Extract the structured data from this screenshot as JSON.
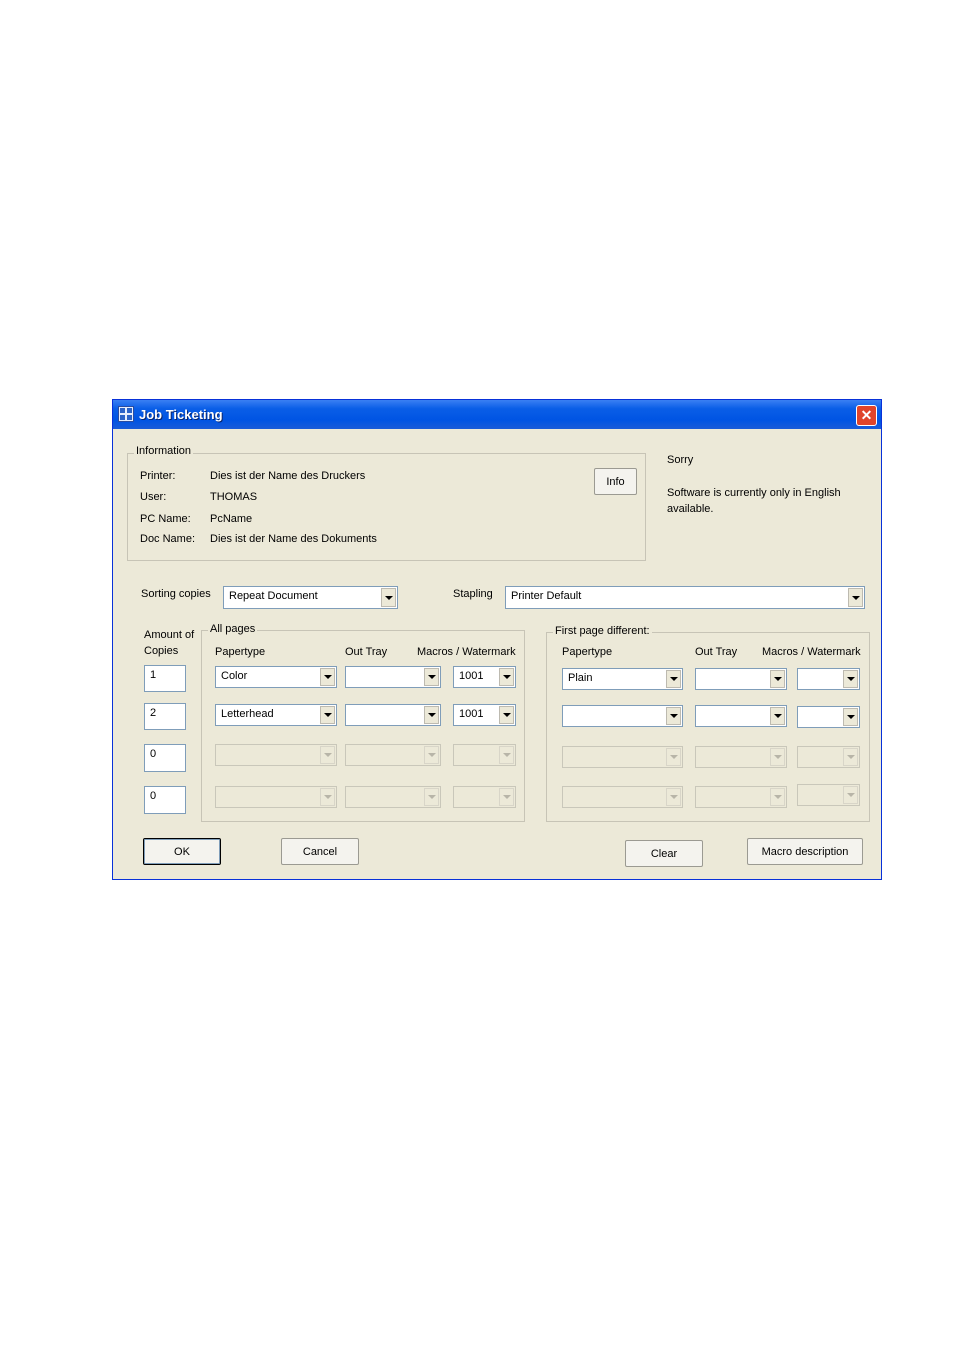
{
  "window": {
    "title": "Job Ticketing",
    "close_label": "✕"
  },
  "info_group": {
    "legend": "Information",
    "rows": [
      {
        "label": "Printer:",
        "value": "Dies ist der Name des Druckers"
      },
      {
        "label": "User:",
        "value": "THOMAS"
      },
      {
        "label": "PC Name:",
        "value": "PcName"
      },
      {
        "label": "Doc Name:",
        "value": "Dies ist der Name des Dokuments"
      }
    ],
    "info_button": "Info"
  },
  "message": {
    "title": "Sorry",
    "body": "Software is currently only in English available."
  },
  "sorting": {
    "label": "Sorting copies",
    "value": "Repeat Document"
  },
  "stapling": {
    "label": "Stapling",
    "value": "Printer Default"
  },
  "amount": {
    "label": "Amount of Copies",
    "values": [
      "1",
      "2",
      "0",
      "0"
    ]
  },
  "all_pages": {
    "legend": "All pages",
    "headers": {
      "papertype": "Papertype",
      "out_tray": "Out Tray",
      "macros": "Macros / Watermark"
    },
    "rows": [
      {
        "papertype": "Color",
        "out_tray": "",
        "macro": "1001"
      },
      {
        "papertype": "Letterhead",
        "out_tray": "",
        "macro": "1001"
      },
      {
        "papertype": "",
        "out_tray": "",
        "macro": ""
      },
      {
        "papertype": "",
        "out_tray": "",
        "macro": ""
      }
    ]
  },
  "first_page": {
    "legend": "First page different:",
    "headers": {
      "papertype": "Papertype",
      "out_tray": "Out Tray",
      "macros": "Macros / Watermark"
    },
    "rows": [
      {
        "papertype": "Plain",
        "out_tray": "",
        "macro": ""
      },
      {
        "papertype": "",
        "out_tray": "",
        "macro": ""
      },
      {
        "papertype": "",
        "out_tray": "",
        "macro": ""
      },
      {
        "papertype": "",
        "out_tray": "",
        "macro": ""
      }
    ]
  },
  "buttons": {
    "ok": "OK",
    "cancel": "Cancel",
    "clear": "Clear",
    "macro_description": "Macro description"
  },
  "colors": {
    "titlebar": "#0054e3",
    "dialog_bg": "#ece9d8",
    "close": "#e0442a"
  }
}
